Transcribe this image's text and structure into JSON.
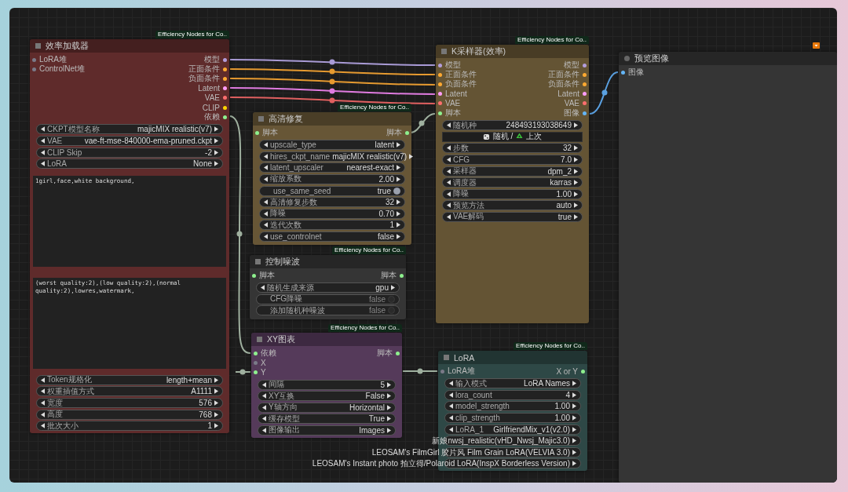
{
  "nodes": [
    {
      "title": "效率加载器",
      "badge": "Efficiency Nodes for Co..",
      "color": "#5f2b2b",
      "kind": "efficiency",
      "inputs": [
        {
          "label": "LoRA堆",
          "color": "#7a7a88"
        },
        {
          "label": "ControlNet堆",
          "color": "#7a7a88"
        }
      ],
      "outputs": [
        {
          "label": "模型",
          "color": "#b39ddb"
        },
        {
          "label": "正面条件",
          "color": "#ffa931"
        },
        {
          "label": "负面条件",
          "color": "#ffa931"
        },
        {
          "label": "Latent",
          "color": "#ff9cf9"
        },
        {
          "label": "VAE",
          "color": "#ff6e6e"
        },
        {
          "label": "CLIP",
          "color": "#ffd500"
        },
        {
          "label": "依赖",
          "color": "#8ef08e"
        }
      ],
      "widgets": [
        {
          "kind": "combo",
          "label": "CKPT模型名称",
          "value": "majicMIX realistic(v7)"
        },
        {
          "kind": "combo",
          "label": "VAE",
          "value": "vae-ft-mse-840000-ema-pruned.ckpt"
        },
        {
          "kind": "combo",
          "label": "CLIP Skip",
          "value": "-2"
        },
        {
          "kind": "combo",
          "label": "LoRA",
          "value": "None"
        },
        {
          "kind": "textarea",
          "value": "1girl,face,white background,"
        },
        {
          "kind": "textarea",
          "value": "(worst quality:2),(low quality:2),(normal quality:2),lowres,watermark,"
        },
        {
          "kind": "combo",
          "label": "Token规格化",
          "value": "length+mean"
        },
        {
          "kind": "combo",
          "label": "权重插值方式",
          "value": "A1111"
        },
        {
          "kind": "combo",
          "label": "宽度",
          "value": "576"
        },
        {
          "kind": "combo",
          "label": "高度",
          "value": "768"
        },
        {
          "kind": "combo",
          "label": "批次大小",
          "value": "1"
        }
      ]
    },
    {
      "title": "高清修复",
      "badge": "Efficiency Nodes for Co..",
      "color": "#675636",
      "kind": "efficiency",
      "inputs": [
        {
          "label": "脚本",
          "color": "#8ef08e"
        }
      ],
      "outputs": [
        {
          "label": "脚本",
          "color": "#8ef08e"
        }
      ],
      "widgets": [
        {
          "kind": "combo",
          "label": "upscale_type",
          "value": "latent"
        },
        {
          "kind": "combo",
          "label": "hires_ckpt_name",
          "value": "majicMIX realistic(v7)"
        },
        {
          "kind": "combo",
          "label": "latent_upscaler",
          "value": "nearest-exact"
        },
        {
          "kind": "combo",
          "label": "缩放系数",
          "value": "2.00"
        },
        {
          "kind": "toggle",
          "label": "use_same_seed",
          "value": "true",
          "on": true
        },
        {
          "kind": "combo",
          "label": "高清修复步数",
          "value": "32"
        },
        {
          "kind": "combo",
          "label": "降噪",
          "value": "0.70"
        },
        {
          "kind": "combo",
          "label": "迭代次数",
          "value": "1"
        },
        {
          "kind": "combo",
          "label": "use_controlnet",
          "value": "false"
        }
      ]
    },
    {
      "title": "控制噪波",
      "badge": "Efficiency Nodes for Co..",
      "color": "#353535",
      "kind": "efficiency",
      "inputs": [
        {
          "label": "脚本",
          "color": "#8ef08e"
        }
      ],
      "outputs": [
        {
          "label": "脚本",
          "color": "#8ef08e"
        }
      ],
      "widgets": [
        {
          "kind": "combo",
          "label": "随机生成来源",
          "value": "gpu"
        },
        {
          "kind": "toggle",
          "label": "CFG降噪",
          "value": "false",
          "on": false
        },
        {
          "kind": "toggle",
          "label": "添加随机种噪波",
          "value": "false",
          "on": false
        }
      ]
    },
    {
      "title": "XY图表",
      "badge": "Efficiency Nodes for Co..",
      "color": "#553a5a",
      "kind": "efficiency",
      "inputs": [
        {
          "label": "依赖",
          "color": "#8ef08e"
        },
        {
          "label": "X",
          "color": "#7a7a88"
        },
        {
          "label": "Y",
          "color": "#8ef08e"
        }
      ],
      "outputs": [
        {
          "label": "脚本",
          "color": "#8ef08e"
        }
      ],
      "widgets": [
        {
          "kind": "combo",
          "label": "间隔",
          "value": "5"
        },
        {
          "kind": "combo",
          "label": "XY互换",
          "value": "False"
        },
        {
          "kind": "combo",
          "label": "Y轴方向",
          "value": "Horizontal"
        },
        {
          "kind": "combo",
          "label": "缓存模型",
          "value": "True"
        },
        {
          "kind": "combo",
          "label": "图像输出",
          "value": "Images"
        }
      ]
    },
    {
      "title": "K采样器(效率)",
      "badge": "Efficiency Nodes for Co..",
      "color": "#645434",
      "kind": "efficiency",
      "inputs": [
        {
          "label": "模型",
          "color": "#b39ddb"
        },
        {
          "label": "正面条件",
          "color": "#ffa931"
        },
        {
          "label": "负面条件",
          "color": "#ffa931"
        },
        {
          "label": "Latent",
          "color": "#ff9cf9"
        },
        {
          "label": "VAE",
          "color": "#ff6e6e"
        },
        {
          "label": "脚本",
          "color": "#8ef08e"
        }
      ],
      "outputs": [
        {
          "label": "模型",
          "color": "#b39ddb"
        },
        {
          "label": "正面条件",
          "color": "#ffa931"
        },
        {
          "label": "负面条件",
          "color": "#ffa931"
        },
        {
          "label": "Latent",
          "color": "#ff9cf9"
        },
        {
          "label": "VAE",
          "color": "#ff6e6e"
        },
        {
          "label": "图像",
          "color": "#64b5f6"
        }
      ],
      "widgets": [
        {
          "kind": "combo",
          "label": "随机种",
          "value": "248493193038649"
        },
        {
          "kind": "button",
          "label": "随机 /",
          "value": "上次"
        },
        {
          "kind": "combo",
          "label": "步数",
          "value": "32"
        },
        {
          "kind": "combo",
          "label": "CFG",
          "value": "7.0"
        },
        {
          "kind": "combo",
          "label": "采样器",
          "value": "dpm_2"
        },
        {
          "kind": "combo",
          "label": "调度器",
          "value": "karras"
        },
        {
          "kind": "combo",
          "label": "降噪",
          "value": "1.00"
        },
        {
          "kind": "combo",
          "label": "预览方法",
          "value": "auto"
        },
        {
          "kind": "combo",
          "label": "VAE解码",
          "value": "true"
        }
      ]
    },
    {
      "title": "预览图像",
      "color": "#353535",
      "kind": "preview",
      "inputs": [
        {
          "label": "图像",
          "color": "#64b5f6"
        }
      ]
    },
    {
      "title": "LoRA",
      "badge": "Efficiency Nodes for Co..",
      "color": "#2e4846",
      "kind": "efficiency",
      "inputs": [
        {
          "label": "LoRA堆",
          "color": "#7a7a88"
        }
      ],
      "outputs": [
        {
          "label": "X or Y",
          "color": "#8ef08e"
        }
      ],
      "widgets": [
        {
          "kind": "combo",
          "label": "输入模式",
          "value": "LoRA Names"
        },
        {
          "kind": "combo",
          "label": "lora_count",
          "value": "4"
        },
        {
          "kind": "combo",
          "label": "model_strength",
          "value": "1.00"
        },
        {
          "kind": "combo",
          "label": "clip_strength",
          "value": "1.00"
        },
        {
          "kind": "combo",
          "label": "LoRA_1",
          "value": "GirlfriendMix_v1(v2.0)"
        },
        {
          "kind": "combo",
          "value": "新娘nwsj_realistic(vHD_Nwsj_Majic3.0)"
        },
        {
          "kind": "combo",
          "value": "LEOSAM's FilmGirl 胶片风 Film Grain LoRA(VELVIA 3.0)"
        },
        {
          "kind": "combo",
          "value": "LEOSAM's Instant photo 拍立得/Polaroid LoRA(InspX Borderless Version)"
        }
      ]
    }
  ]
}
